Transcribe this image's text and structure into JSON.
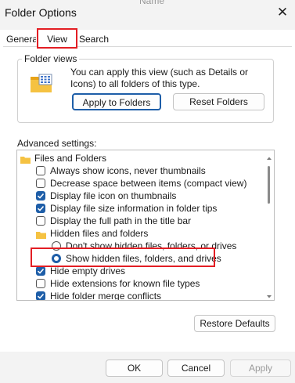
{
  "window": {
    "title": "Folder Options",
    "partial_background_text": "Name",
    "close_glyph": "✕"
  },
  "tabs": [
    {
      "label": "General",
      "selected": false
    },
    {
      "label": "View",
      "selected": true
    },
    {
      "label": "Search",
      "selected": false
    }
  ],
  "folder_views": {
    "group_label": "Folder views",
    "description": "You can apply this view (such as Details or Icons) to all folders of this type.",
    "apply_label": "Apply to Folders",
    "reset_label": "Reset Folders"
  },
  "advanced": {
    "label": "Advanced settings:",
    "items": [
      {
        "kind": "folder",
        "level": 0,
        "label": "Files and Folders"
      },
      {
        "kind": "checkbox",
        "level": 1,
        "label": "Always show icons, never thumbnails",
        "checked": false
      },
      {
        "kind": "checkbox",
        "level": 1,
        "label": "Decrease space between items (compact view)",
        "checked": false
      },
      {
        "kind": "checkbox",
        "level": 1,
        "label": "Display file icon on thumbnails",
        "checked": true
      },
      {
        "kind": "checkbox",
        "level": 1,
        "label": "Display file size information in folder tips",
        "checked": true
      },
      {
        "kind": "checkbox",
        "level": 1,
        "label": "Display the full path in the title bar",
        "checked": false
      },
      {
        "kind": "folder",
        "level": 1,
        "label": "Hidden files and folders"
      },
      {
        "kind": "radio",
        "level": 2,
        "label": "Don't show hidden files, folders, or drives",
        "checked": false
      },
      {
        "kind": "radio",
        "level": 2,
        "label": "Show hidden files, folders, and drives",
        "checked": true
      },
      {
        "kind": "checkbox",
        "level": 1,
        "label": "Hide empty drives",
        "checked": true
      },
      {
        "kind": "checkbox",
        "level": 1,
        "label": "Hide extensions for known file types",
        "checked": false
      },
      {
        "kind": "checkbox",
        "level": 1,
        "label": "Hide folder merge conflicts",
        "checked": true
      }
    ]
  },
  "buttons": {
    "restore_defaults": "Restore Defaults",
    "ok": "OK",
    "cancel": "Cancel",
    "apply": "Apply"
  },
  "colors": {
    "accent": "#1e5ea8",
    "annotation_red": "#e31e24",
    "folder_yellow": "#f5c242"
  }
}
